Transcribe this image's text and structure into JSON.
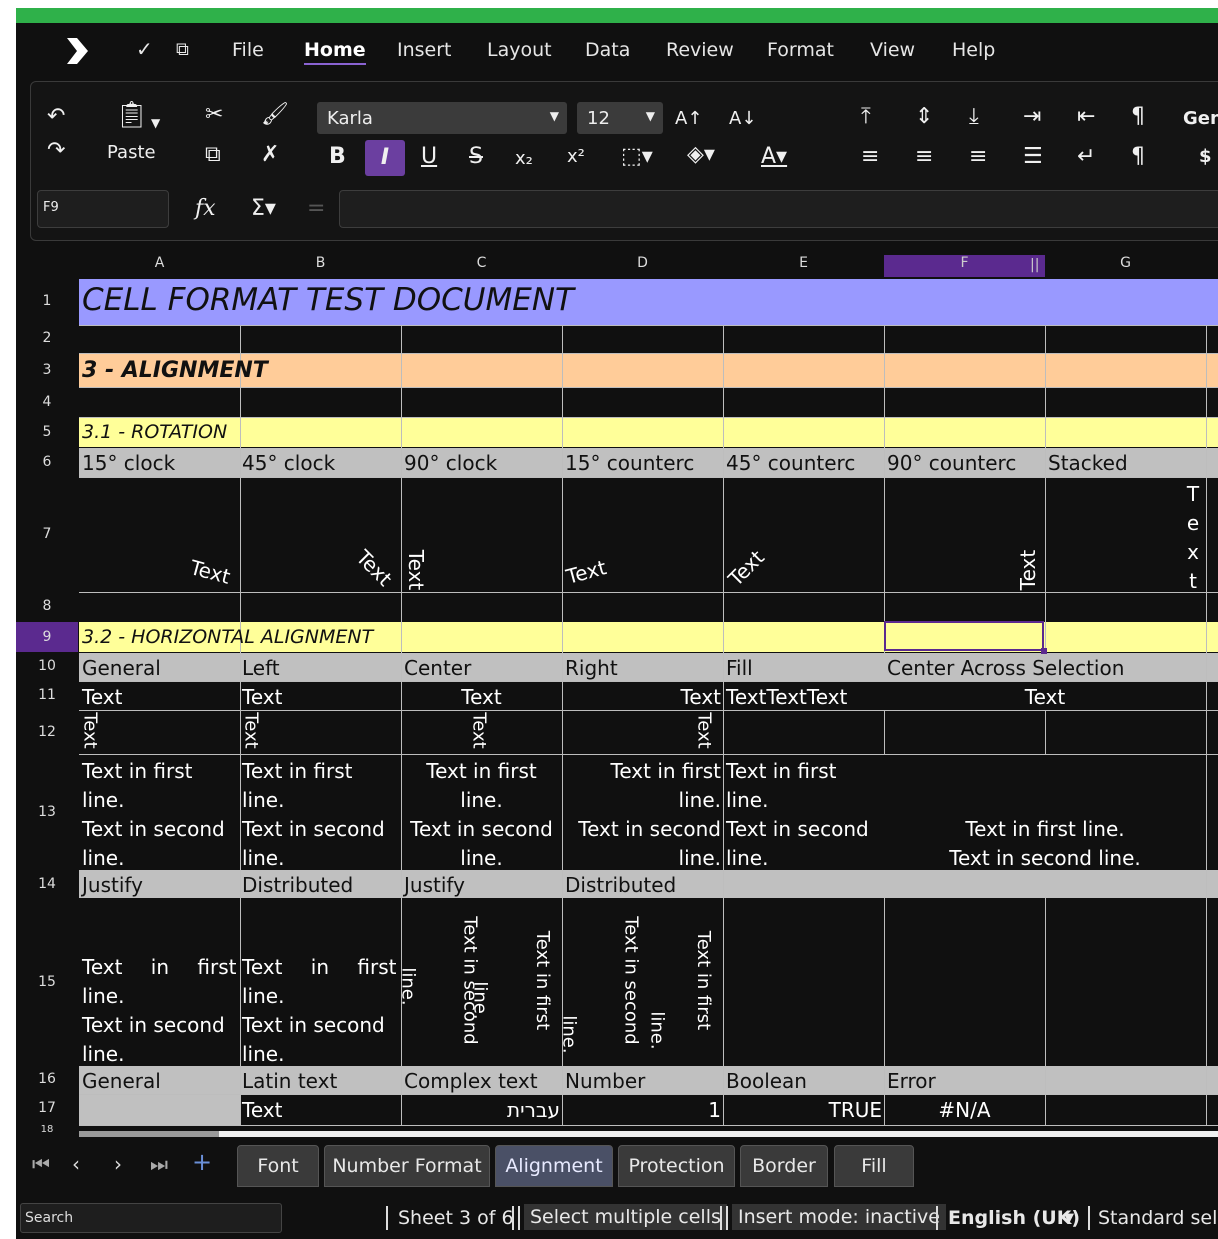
{
  "menu": {
    "items": [
      "File",
      "Home",
      "Insert",
      "Layout",
      "Data",
      "Review",
      "Format",
      "View",
      "Help"
    ],
    "active": "Home"
  },
  "toolbar": {
    "paste_label": "Paste",
    "font_name": "Karla",
    "font_size": "12",
    "number_format": "Gen",
    "currency": "$"
  },
  "formula_bar": {
    "cell_ref": "F9",
    "formula": ""
  },
  "columns": [
    "A",
    "B",
    "C",
    "D",
    "E",
    "F",
    "G"
  ],
  "selected_column": "F",
  "rows": [
    "1",
    "2",
    "3",
    "4",
    "5",
    "6",
    "7",
    "8",
    "9",
    "10",
    "11",
    "12",
    "13",
    "14",
    "15",
    "16",
    "17",
    "18"
  ],
  "selected_row": "9",
  "sheet": {
    "title": "CELL FORMAT TEST DOCUMENT",
    "section": "3 - ALIGNMENT",
    "rotation_heading": "3.1 - ROTATION",
    "rotation_labels": [
      "15° clock",
      "45° clock",
      "90° clock",
      "15° counterc",
      "45° counterc",
      "90° counterc",
      "Stacked"
    ],
    "rotation_text": "Text",
    "stacked_letters": [
      "T",
      "e",
      "x",
      "t"
    ],
    "horizontal_heading": "3.2 - HORIZONTAL ALIGNMENT",
    "row10": [
      "General",
      "Left",
      "Center",
      "Right",
      "Fill",
      "Center Across Selection"
    ],
    "row11": [
      "Text",
      "Text",
      "Text",
      "Text",
      "TextTextText",
      "Text"
    ],
    "row12_text": "Text",
    "row13": {
      "first": "Text in first",
      "line": "line.",
      "second": "Text in second",
      "merged_first": "Text in first line.",
      "merged_second": "Text in second line."
    },
    "row14": [
      "Justify",
      "Distributed",
      "Justify",
      "Distributed"
    ],
    "row15": {
      "a_line1": "Text in first",
      "a_line2": "line.",
      "a_line3": "Text in second",
      "a_line4": "line.",
      "v_first": "Text in first",
      "v_line": "line.",
      "v_second": "Text in second"
    },
    "row16": [
      "General",
      "Latin text",
      "Complex text",
      "Number",
      "Boolean",
      "Error"
    ],
    "row17": [
      "",
      "Text",
      "עברית",
      "1",
      "TRUE",
      "#N/A"
    ]
  },
  "tabs": [
    "Font",
    "Number Format",
    "Alignment",
    "Protection",
    "Border",
    "Fill"
  ],
  "active_tab": "Alignment",
  "status": {
    "search_placeholder": "Search",
    "sheet": "Sheet 3 of 6",
    "selection_mode": "Select multiple cells",
    "insert_mode": "Insert mode: inactive",
    "language": "English (UK)",
    "standard": "Standard sele"
  },
  "colors": {
    "title_fill": "#9999ff",
    "section_fill": "#ffcc99",
    "subsection_fill": "#ffff99",
    "label_fill": "#c0c0c0",
    "selection": "#5b2a8f",
    "top_bar": "#2fb14a"
  }
}
